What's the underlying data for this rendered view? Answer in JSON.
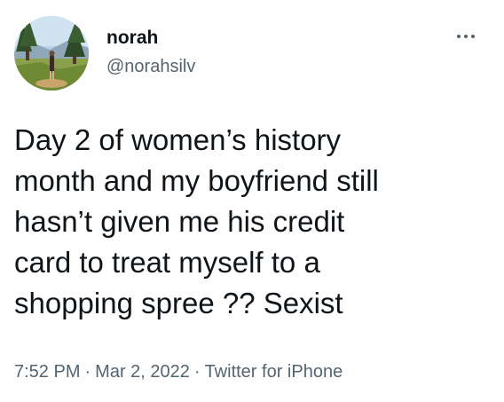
{
  "user": {
    "display_name": "norah",
    "handle": "@norahsilv",
    "avatar_icon": "profile-photo"
  },
  "tweet": {
    "text": "Day 2 of women’s history\nmonth and my boyfriend still\nhasn’t given me his credit\ncard to treat myself to a\nshopping spree ?? Sexist",
    "time": "7:52 PM",
    "date": "Mar 2, 2022",
    "source": "Twitter for iPhone",
    "separator": "·"
  },
  "menu": {
    "icon": "more-options-icon"
  },
  "colors": {
    "text_primary": "#0f1419",
    "text_secondary": "#536471"
  }
}
